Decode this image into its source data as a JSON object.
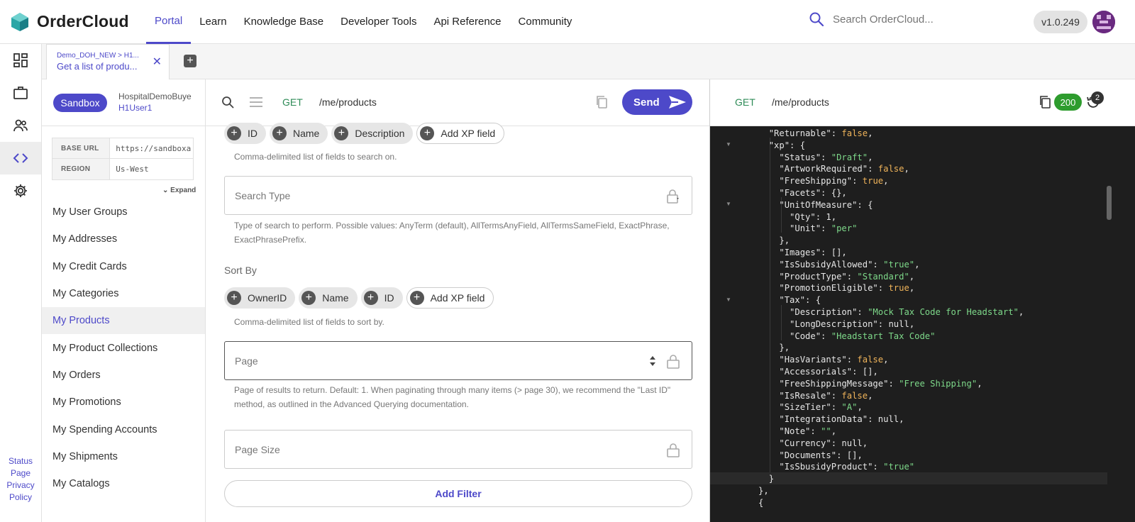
{
  "brand": {
    "name": "OrderCloud"
  },
  "nav": {
    "links": [
      "Portal",
      "Learn",
      "Knowledge Base",
      "Developer Tools",
      "Api Reference",
      "Community"
    ],
    "active": "Portal",
    "search_placeholder": "Search OrderCloud...",
    "version": "v1.0.249"
  },
  "rail": {
    "icons": [
      "dashboard-icon",
      "briefcase-icon",
      "users-icon",
      "code-icon",
      "gear-icon"
    ],
    "footer": [
      "Status",
      "Page",
      "Privacy",
      "Policy"
    ]
  },
  "tab": {
    "crumb": "Demo_DOH_NEW > H1...",
    "title": "Get a list of produ..."
  },
  "sidebar": {
    "environment": "Sandbox",
    "buyer": "HospitalDemoBuye",
    "user": "H1User1",
    "base_url_label": "BASE URL",
    "base_url": "https://sandboxa",
    "region_label": "REGION",
    "region": "Us-West",
    "expand": "Expand",
    "items": [
      "My User Groups",
      "My Addresses",
      "My Credit Cards",
      "My Categories",
      "My Products",
      "My Product Collections",
      "My Orders",
      "My Promotions",
      "My Spending Accounts",
      "My Shipments",
      "My Catalogs"
    ],
    "active_item": "My Products"
  },
  "request": {
    "method": "GET",
    "path": "/me/products",
    "send_label": "Send",
    "search_on_chips": [
      "ID",
      "Name",
      "Description"
    ],
    "add_xp": "Add XP field",
    "search_on_hint": "Comma-delimited list of fields to search on.",
    "search_type_placeholder": "Search Type",
    "search_type_hint": "Type of search to perform. Possible values: AnyTerm (default), AllTermsAnyField, AllTermsSameField, ExactPhrase, ExactPhrasePrefix.",
    "sort_by_label": "Sort By",
    "sort_chips": [
      "OwnerID",
      "Name",
      "ID"
    ],
    "sort_hint": "Comma-delimited list of fields to sort by.",
    "page_placeholder": "Page",
    "page_hint": "Page of results to return. Default: 1. When paginating through many items (> page 30), we recommend the \"Last ID\" method, as outlined in the Advanced Querying documentation.",
    "page_size_placeholder": "Page Size",
    "add_filter": "Add Filter"
  },
  "response": {
    "method": "GET",
    "path": "/me/products",
    "status": "200",
    "history_count": "2",
    "lines": [
      {
        "i": 2,
        "k": "Returnable",
        "v": "false",
        "t": "bool",
        "c": ","
      },
      {
        "i": 2,
        "k": "xp",
        "v": "{",
        "t": "punct",
        "c": ""
      },
      {
        "i": 3,
        "k": "Status",
        "v": "\"Draft\"",
        "t": "str",
        "c": ","
      },
      {
        "i": 3,
        "k": "ArtworkRequired",
        "v": "false",
        "t": "bool",
        "c": ","
      },
      {
        "i": 3,
        "k": "FreeShipping",
        "v": "true",
        "t": "bool",
        "c": ","
      },
      {
        "i": 3,
        "k": "Facets",
        "v": "{}",
        "t": "punct",
        "c": ","
      },
      {
        "i": 3,
        "k": "UnitOfMeasure",
        "v": "{",
        "t": "punct",
        "c": ""
      },
      {
        "i": 4,
        "k": "Qty",
        "v": "1",
        "t": "num",
        "c": ","
      },
      {
        "i": 4,
        "k": "Unit",
        "v": "\"per\"",
        "t": "str",
        "c": ""
      },
      {
        "i": 3,
        "k": "",
        "v": "},",
        "t": "punct",
        "c": ""
      },
      {
        "i": 3,
        "k": "Images",
        "v": "[]",
        "t": "punct",
        "c": ","
      },
      {
        "i": 3,
        "k": "IsSubsidyAllowed",
        "v": "\"true\"",
        "t": "str",
        "c": ","
      },
      {
        "i": 3,
        "k": "ProductType",
        "v": "\"Standard\"",
        "t": "str",
        "c": ","
      },
      {
        "i": 3,
        "k": "PromotionEligible",
        "v": "true",
        "t": "bool",
        "c": ","
      },
      {
        "i": 3,
        "k": "Tax",
        "v": "{",
        "t": "punct",
        "c": ""
      },
      {
        "i": 4,
        "k": "Description",
        "v": "\"Mock Tax Code for Headstart\"",
        "t": "str",
        "c": ","
      },
      {
        "i": 4,
        "k": "LongDescription",
        "v": "null",
        "t": "num",
        "c": ","
      },
      {
        "i": 4,
        "k": "Code",
        "v": "\"Headstart Tax Code\"",
        "t": "str",
        "c": ""
      },
      {
        "i": 3,
        "k": "",
        "v": "},",
        "t": "punct",
        "c": ""
      },
      {
        "i": 3,
        "k": "HasVariants",
        "v": "false",
        "t": "bool",
        "c": ","
      },
      {
        "i": 3,
        "k": "Accessorials",
        "v": "[]",
        "t": "punct",
        "c": ","
      },
      {
        "i": 3,
        "k": "FreeShippingMessage",
        "v": "\"Free Shipping\"",
        "t": "str",
        "c": ","
      },
      {
        "i": 3,
        "k": "IsResale",
        "v": "false",
        "t": "bool",
        "c": ","
      },
      {
        "i": 3,
        "k": "SizeTier",
        "v": "\"A\"",
        "t": "str",
        "c": ","
      },
      {
        "i": 3,
        "k": "IntegrationData",
        "v": "null",
        "t": "num",
        "c": ","
      },
      {
        "i": 3,
        "k": "Note",
        "v": "\"\"",
        "t": "str",
        "c": ","
      },
      {
        "i": 3,
        "k": "Currency",
        "v": "null",
        "t": "num",
        "c": ","
      },
      {
        "i": 3,
        "k": "Documents",
        "v": "[]",
        "t": "punct",
        "c": ","
      },
      {
        "i": 3,
        "k": "IsSbusidyProduct",
        "v": "\"true\"",
        "t": "str",
        "c": ""
      },
      {
        "i": 2,
        "k": "",
        "v": "}",
        "t": "punct",
        "c": ""
      },
      {
        "i": 1,
        "k": "",
        "v": "},",
        "t": "punct",
        "c": ""
      },
      {
        "i": 1,
        "k": "",
        "v": "{",
        "t": "punct",
        "c": ""
      }
    ]
  },
  "colors": {
    "accent": "#4d49c9",
    "success": "#2e9c2e",
    "get": "#2e8b57"
  }
}
